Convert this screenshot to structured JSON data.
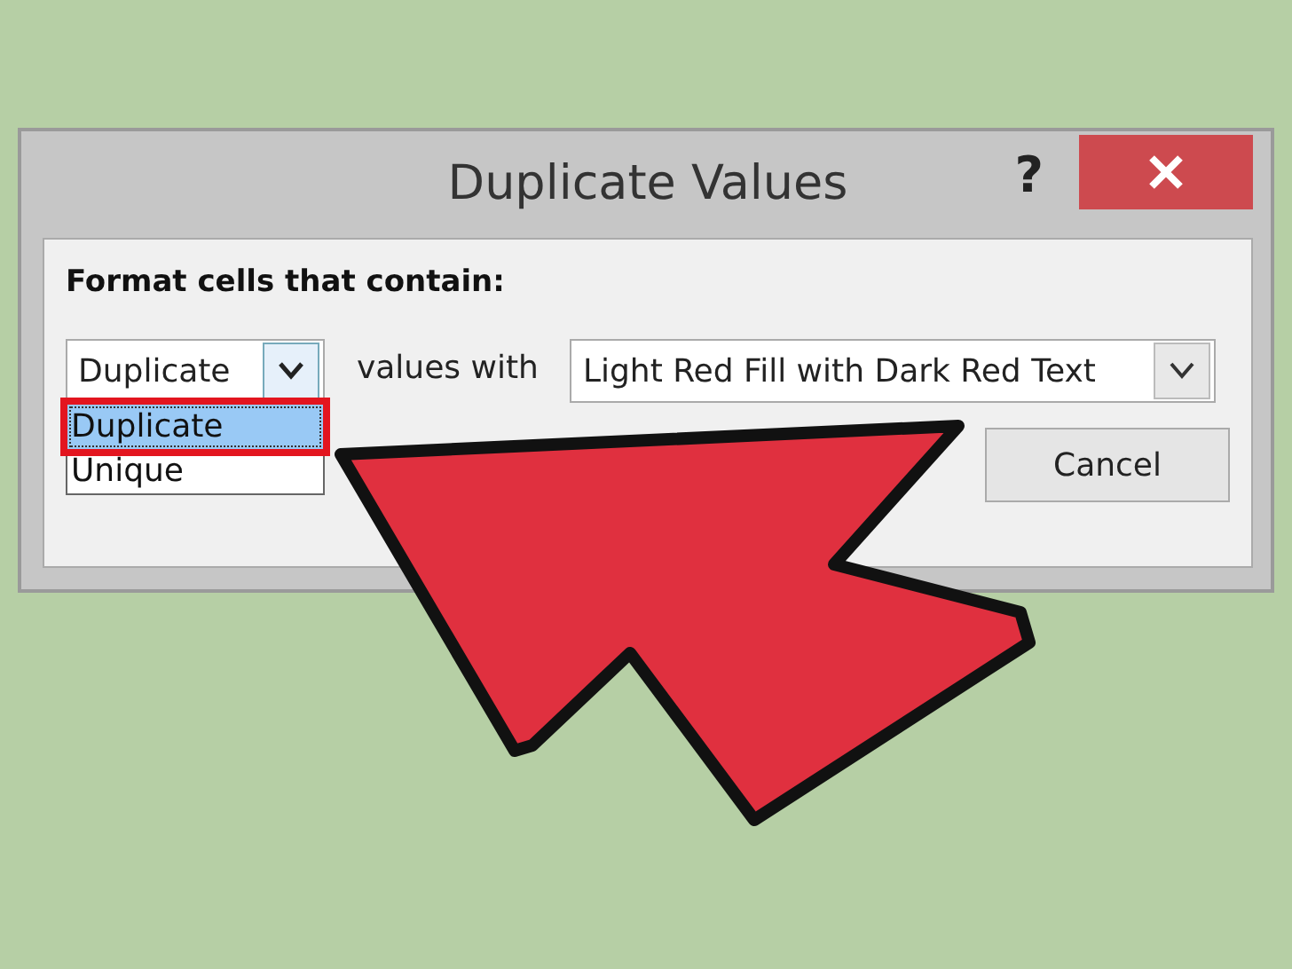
{
  "window": {
    "title": "Duplicate Values",
    "help": "?"
  },
  "prompt": "Format cells that contain:",
  "type_select": {
    "value": "Duplicate",
    "expanded": true,
    "options": [
      {
        "label": "Duplicate",
        "selected": true
      },
      {
        "label": "Unique",
        "selected": false
      }
    ]
  },
  "connector": "values with",
  "format_select": {
    "value": "Light Red Fill with Dark Red Text"
  },
  "buttons": [
    "Cancel"
  ]
}
